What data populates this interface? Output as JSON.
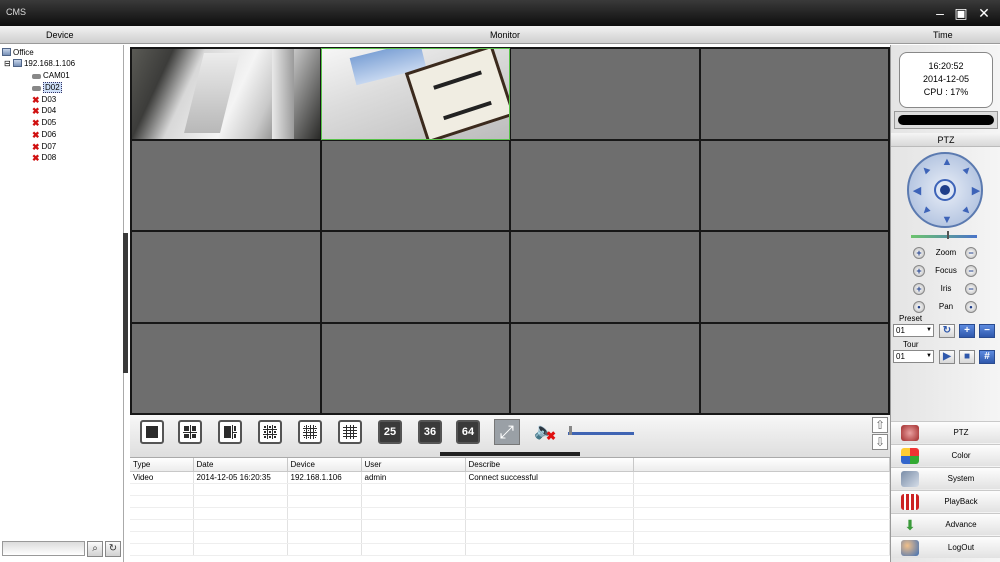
{
  "window": {
    "title": "CMS"
  },
  "header": {
    "device": "Device",
    "monitor": "Monitor",
    "time": "Time"
  },
  "tree": {
    "root": "Office",
    "host": "192.168.1.106",
    "channels": [
      "CAM01",
      "D02",
      "D03",
      "D04",
      "D05",
      "D06",
      "D07",
      "D08"
    ],
    "selected": "D02"
  },
  "video": {
    "cells": 16,
    "osd1": "",
    "osd2": ""
  },
  "toolbar": {
    "split_numbers": [
      "25",
      "36",
      "64"
    ],
    "volume_level": 0.02
  },
  "log": {
    "columns": [
      "Type",
      "Date",
      "Device",
      "User",
      "Describe"
    ],
    "rows": [
      {
        "type": "Video",
        "date": "2014-12-05 16:20:35",
        "device": "192.168.1.106",
        "user": "admin",
        "describe": "Connect successful"
      }
    ]
  },
  "status": {
    "time": "16:20:52",
    "date": "2014-12-05",
    "cpu": "CPU : 17%"
  },
  "ptz": {
    "title": "PTZ",
    "zoom": "Zoom",
    "focus": "Focus",
    "iris": "Iris",
    "pan": "Pan",
    "preset_label": "Preset",
    "preset_value": "01",
    "tour_label": "Tour",
    "tour_value": "01",
    "speed_level": 0.55
  },
  "menu": [
    "PTZ",
    "Color",
    "System",
    "PlayBack",
    "Advance",
    "LogOut"
  ]
}
